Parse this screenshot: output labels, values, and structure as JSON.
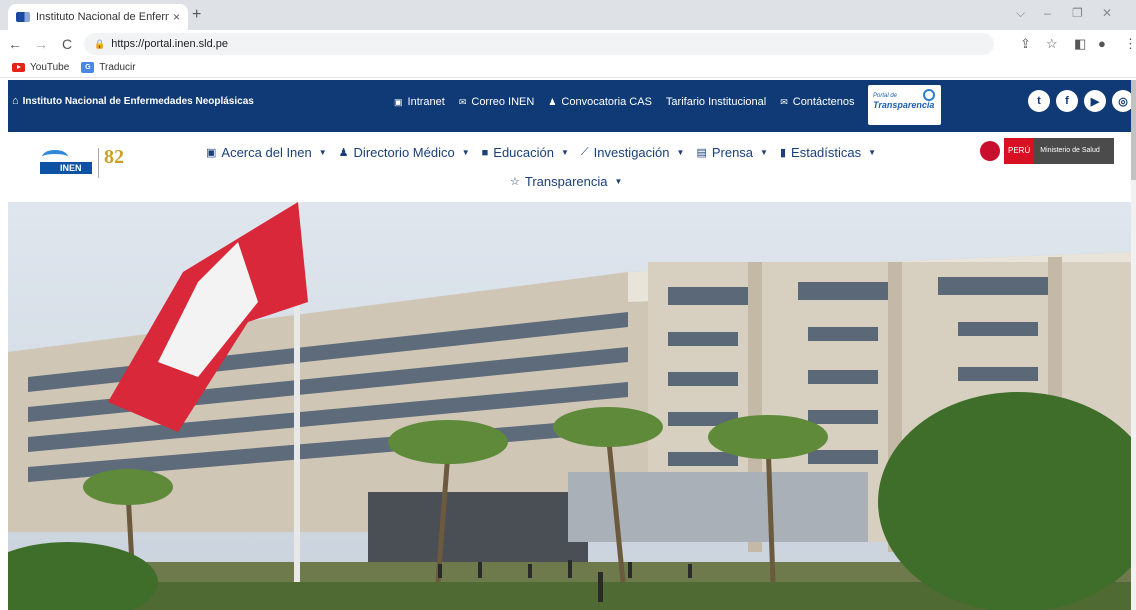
{
  "browser": {
    "tab_title": "Instituto Nacional de Enfermeda",
    "tab_close": "×",
    "new_tab": "+",
    "url": "https://portal.inen.sld.pe",
    "bookmarks": [
      {
        "label": "YouTube"
      },
      {
        "label": "Traducir"
      }
    ]
  },
  "site": {
    "brand": "Instituto Nacional de Enfermedades Neoplásicas",
    "top_links": [
      {
        "label": "Intranet",
        "icon": "id-card-icon"
      },
      {
        "label": "Correo INEN",
        "icon": "mail-icon"
      },
      {
        "label": "Convocatoria CAS",
        "icon": "person-icon"
      },
      {
        "label": "Tarifario Institucional",
        "icon": ""
      },
      {
        "label": "Contáctenos",
        "icon": "mail-icon"
      }
    ],
    "transparency": {
      "line1": "Portal de",
      "line2": "Transparencia"
    },
    "socials": [
      "twitter-icon",
      "facebook-icon",
      "youtube-icon",
      "instagram-icon"
    ],
    "logo": {
      "name": "INEN",
      "years": "82"
    },
    "nav": [
      {
        "label": "Acerca del Inen",
        "icon": "about-icon"
      },
      {
        "label": "Directorio Médico",
        "icon": "doctor-icon"
      },
      {
        "label": "Educación",
        "icon": "book-icon"
      },
      {
        "label": "Investigación",
        "icon": "chart-line-icon"
      },
      {
        "label": "Prensa",
        "icon": "newspaper-icon"
      },
      {
        "label": "Estadísticas",
        "icon": "bar-chart-icon"
      }
    ],
    "nav_row2": {
      "label": "Transparencia",
      "icon": "star-icon"
    },
    "ministry": {
      "country": "PERÚ",
      "name": "Ministerio de Salud"
    }
  },
  "colors": {
    "brand_blue": "#0f3a75",
    "nav_text": "#1a3f7a",
    "peru_red": "#d91023"
  }
}
